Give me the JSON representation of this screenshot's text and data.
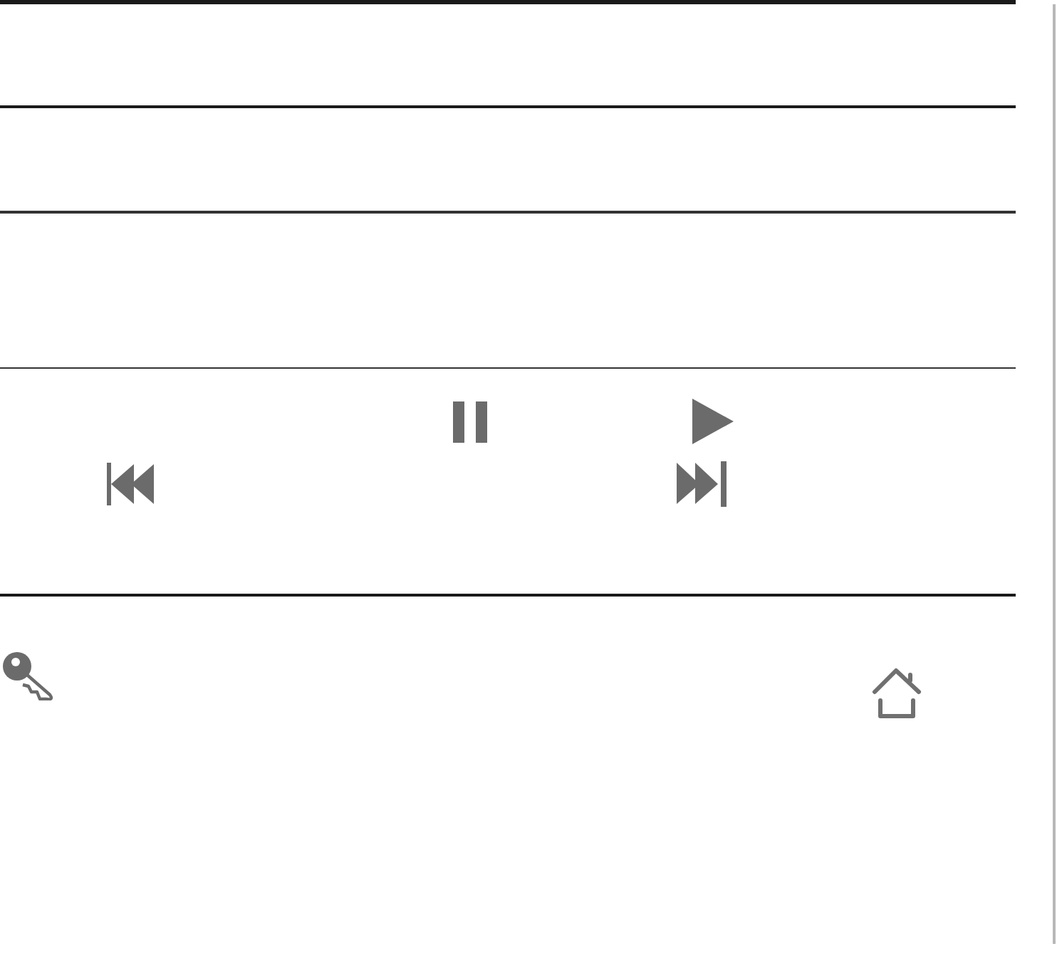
{
  "media_controls": [
    {
      "kind": "pause"
    },
    {
      "kind": "play"
    },
    {
      "kind": "previous"
    },
    {
      "kind": "next"
    }
  ],
  "bottom_icons": [
    {
      "kind": "key"
    },
    {
      "kind": "home"
    }
  ]
}
